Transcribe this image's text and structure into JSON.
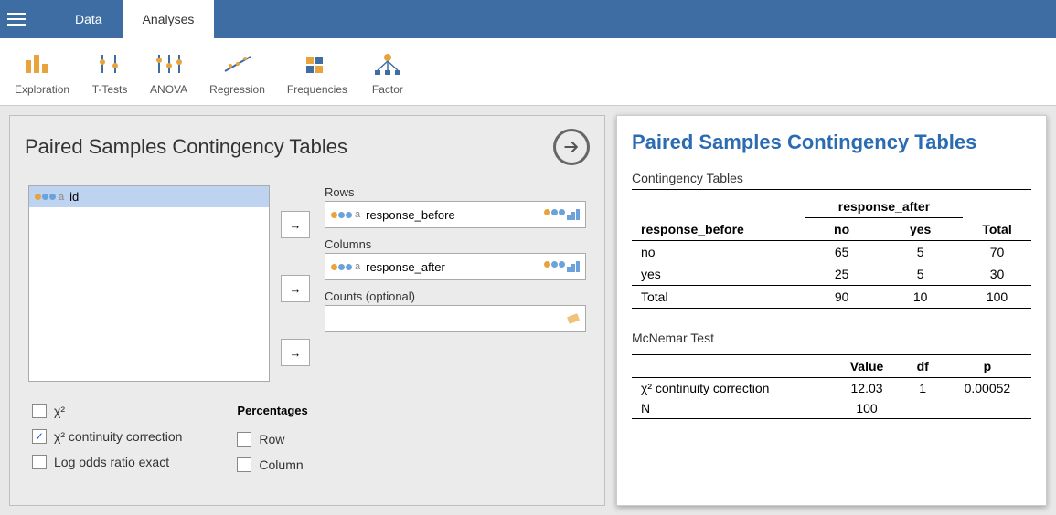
{
  "tabs": {
    "data": "Data",
    "analyses": "Analyses"
  },
  "ribbon": {
    "exploration": "Exploration",
    "ttests": "T-Tests",
    "anova": "ANOVA",
    "regression": "Regression",
    "frequencies": "Frequencies",
    "factor": "Factor"
  },
  "panel": {
    "title": "Paired Samples Contingency Tables",
    "vars": {
      "id": "id"
    },
    "labels": {
      "rows": "Rows",
      "columns": "Columns",
      "counts": "Counts (optional)"
    },
    "values": {
      "rows": "response_before",
      "columns": "response_after",
      "counts": ""
    },
    "opts": {
      "percentages_header": "Percentages",
      "chi2": "χ²",
      "chi2cc": "χ² continuity correction",
      "logodds": "Log odds ratio exact",
      "row": "Row",
      "column": "Column",
      "checked": {
        "chi2": false,
        "chi2cc": true,
        "logodds": false,
        "row": false,
        "column": false
      }
    }
  },
  "results": {
    "title": "Paired Samples Contingency Tables",
    "ct": {
      "label": "Contingency Tables",
      "row_var": "response_before",
      "col_var": "response_after",
      "col_levels": [
        "no",
        "yes"
      ],
      "rows": [
        {
          "label": "no",
          "cells": [
            65,
            5
          ],
          "total": 70
        },
        {
          "label": "yes",
          "cells": [
            25,
            5
          ],
          "total": 30
        }
      ],
      "col_totals": [
        90,
        10
      ],
      "grand_total": 100,
      "total_label": "Total"
    },
    "mcn": {
      "label": "McNemar Test",
      "headers": [
        "Value",
        "df",
        "p"
      ],
      "rows": [
        {
          "label": "χ² continuity correction",
          "value": "12.03",
          "df": "1",
          "p": "0.00052"
        },
        {
          "label": "N",
          "value": "100",
          "df": "",
          "p": ""
        }
      ]
    }
  }
}
